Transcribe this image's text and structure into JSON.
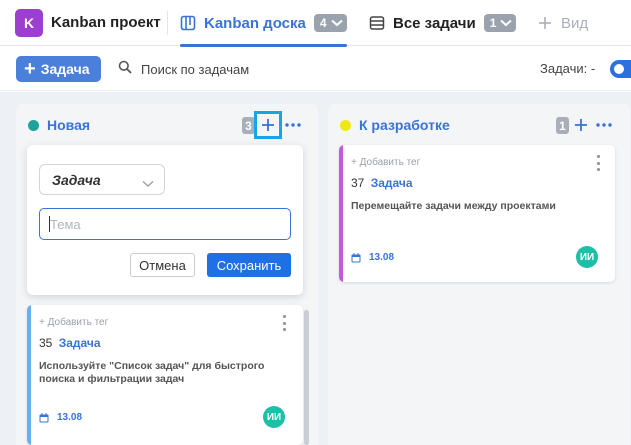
{
  "project": {
    "badge": "K",
    "name": "Kanban проект",
    "badge_color": "#9c3fd0"
  },
  "tabs": [
    {
      "label": "Kanban доска",
      "count": "4",
      "icon": "kanban-board-icon",
      "active": true
    },
    {
      "label": "Все задачи",
      "count": "1",
      "icon": "list-icon",
      "active": false
    },
    {
      "label": "Вид",
      "icon": "plus-icon",
      "active": false
    }
  ],
  "toolbar": {
    "add_task_label": "Задача",
    "search_placeholder": "Поиск по задачам",
    "tasks_filter_label": "Задачи: -"
  },
  "columns": [
    {
      "title": "Новая",
      "count": "3",
      "dot_color": "#1ba39c"
    },
    {
      "title": "К разработке",
      "count": "1",
      "dot_color": "#f0e815"
    }
  ],
  "quick_add": {
    "type_value": "Задача",
    "subject_placeholder": "Тема",
    "cancel_label": "Отмена",
    "save_label": "Сохранить"
  },
  "cards": [
    {
      "column": "Новая",
      "add_tag": "+ Добавить тег",
      "number": "35",
      "type": "Задача",
      "description": "Используйте \"Список задач\" для быстрого поиска и фильтрации задач",
      "date": "13.08",
      "assignee": "ИИ",
      "stripe_color": "#6aaef0"
    },
    {
      "column": "К разработке",
      "add_tag": "+ Добавить тег",
      "number": "37",
      "type": "Задача",
      "description": "Перемещайте задачи между проектами",
      "date": "13.08",
      "assignee": "ИИ",
      "stripe_color": "#c25bd9"
    }
  ],
  "colors": {
    "accent": "#3a73d6",
    "primary_button": "#1f6fe5",
    "avatar": "#1dbfa7"
  }
}
